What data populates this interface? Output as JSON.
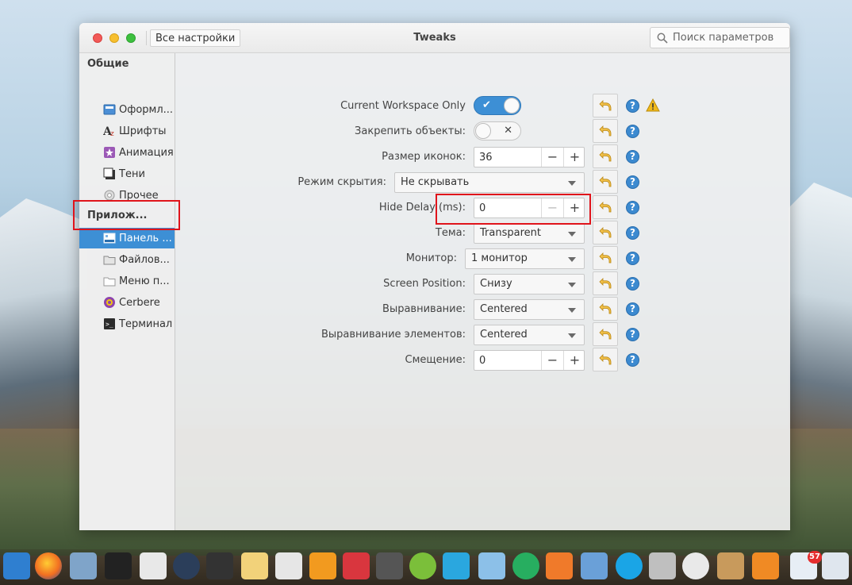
{
  "window": {
    "title": "Tweaks",
    "all_settings_label": "Все настройки",
    "search_placeholder": "Поиск параметров"
  },
  "sidebar": {
    "group_general": "Общие",
    "group_apps": "Прилож...",
    "items": [
      {
        "label": "Оформл...",
        "icon": "appearance-icon"
      },
      {
        "label": "Шрифты",
        "icon": "fonts-icon"
      },
      {
        "label": "Анимация",
        "icon": "animation-icon"
      },
      {
        "label": "Тени",
        "icon": "shadows-icon"
      },
      {
        "label": "Прочее",
        "icon": "misc-icon"
      },
      {
        "label": "Панель ...",
        "icon": "panel-icon",
        "selected": true
      },
      {
        "label": "Файлов...",
        "icon": "folder-icon"
      },
      {
        "label": "Меню п...",
        "icon": "menu-icon"
      },
      {
        "label": "Cerbere",
        "icon": "cerbere-icon"
      },
      {
        "label": "Терминал",
        "icon": "terminal-icon"
      }
    ]
  },
  "settings": {
    "current_workspace": {
      "label": "Current Workspace Only",
      "state": "on"
    },
    "lock_items": {
      "label": "Закрепить объекты:",
      "state": "off"
    },
    "icon_size": {
      "label": "Размер иконок:",
      "value": "36",
      "minus": "−",
      "plus": "+"
    },
    "hide_mode": {
      "label": "Режим скрытия:",
      "value": "Не скрывать"
    },
    "hide_delay": {
      "label": "Hide Delay (ms):",
      "value": "0",
      "minus": "−",
      "plus": "+"
    },
    "theme": {
      "label": "Тема:",
      "value": "Transparent"
    },
    "monitor": {
      "label": "Монитор:",
      "value": "1 монитор"
    },
    "screen_position": {
      "label": "Screen Position:",
      "value": "Снизу"
    },
    "alignment": {
      "label": "Выравнивание:",
      "value": "Centered"
    },
    "items_alignment": {
      "label": "Выравнивание элементов:",
      "value": "Centered"
    },
    "offset": {
      "label": "Смещение:",
      "value": "0",
      "minus": "−",
      "plus": "+"
    }
  },
  "help_glyph": "?",
  "dock": {
    "badge_count": "57"
  },
  "colors": {
    "accent": "#3d8fd5",
    "highlight": "#e0141b",
    "help": "#3c8ad0",
    "warning": "#f0b91a"
  }
}
